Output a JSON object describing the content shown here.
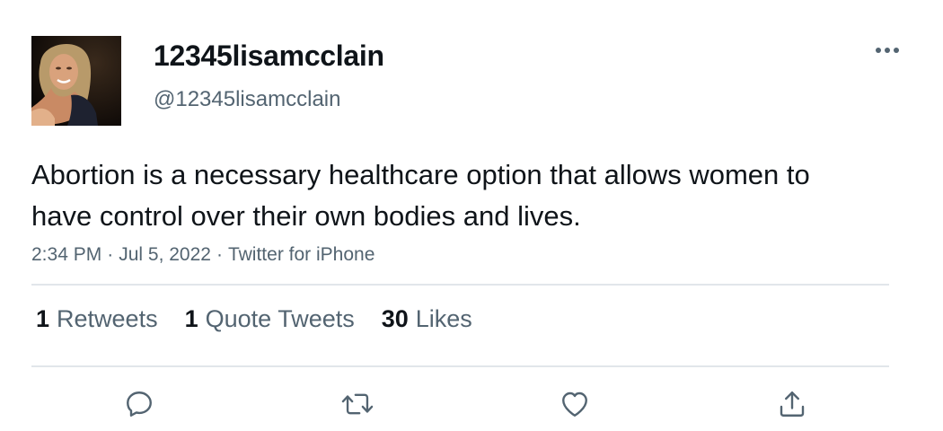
{
  "tweet": {
    "display_name": "12345lisamcclain",
    "handle": "@12345lisamcclain",
    "text": "Abortion is a necessary healthcare option that allows women to have control over their own bodies and lives.",
    "time": "2:34 PM",
    "date": "Jul 5, 2022",
    "source": "Twitter for iPhone",
    "separator": "·"
  },
  "stats": {
    "retweets_count": "1",
    "retweets_label": "Retweets",
    "quotes_count": "1",
    "quotes_label": "Quote Tweets",
    "likes_count": "30",
    "likes_label": "Likes"
  },
  "icons": {
    "more": "more-horizontal-icon",
    "reply": "reply-icon",
    "retweet": "retweet-icon",
    "like": "heart-icon",
    "share": "share-icon"
  },
  "colors": {
    "text_primary": "#0f1419",
    "text_secondary": "#536471",
    "divider": "#e1e6ea"
  }
}
